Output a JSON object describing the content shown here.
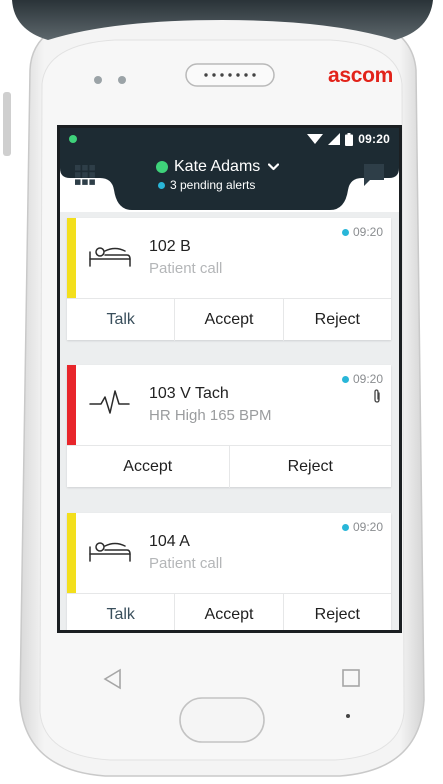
{
  "device": {
    "brand": "ascom"
  },
  "status_bar": {
    "time": "09:20"
  },
  "header": {
    "user_name": "Kate Adams",
    "pending_alerts": "3 pending alerts"
  },
  "alerts": [
    {
      "title": "102 B",
      "subtitle": "Patient call",
      "time": "09:20",
      "priority_color": "#f3df1c",
      "icon": "patient-bed-icon",
      "has_attachment": false,
      "actions": [
        "Talk",
        "Accept",
        "Reject"
      ]
    },
    {
      "title": "103 V Tach",
      "subtitle": "HR High 165 BPM",
      "time": "09:20",
      "priority_color": "#e8262b",
      "icon": "heartbeat-icon",
      "has_attachment": true,
      "actions": [
        "Accept",
        "Reject"
      ]
    },
    {
      "title": "104 A",
      "subtitle": "Patient call",
      "time": "09:20",
      "priority_color": "#f3df1c",
      "icon": "patient-bed-icon",
      "has_attachment": false,
      "actions": [
        "Talk",
        "Accept",
        "Reject"
      ]
    }
  ],
  "colors": {
    "header_dark": "#1d2b33",
    "status_green": "#3ed27a",
    "info_blue": "#29b6d8",
    "brand_red": "#e2231a"
  }
}
